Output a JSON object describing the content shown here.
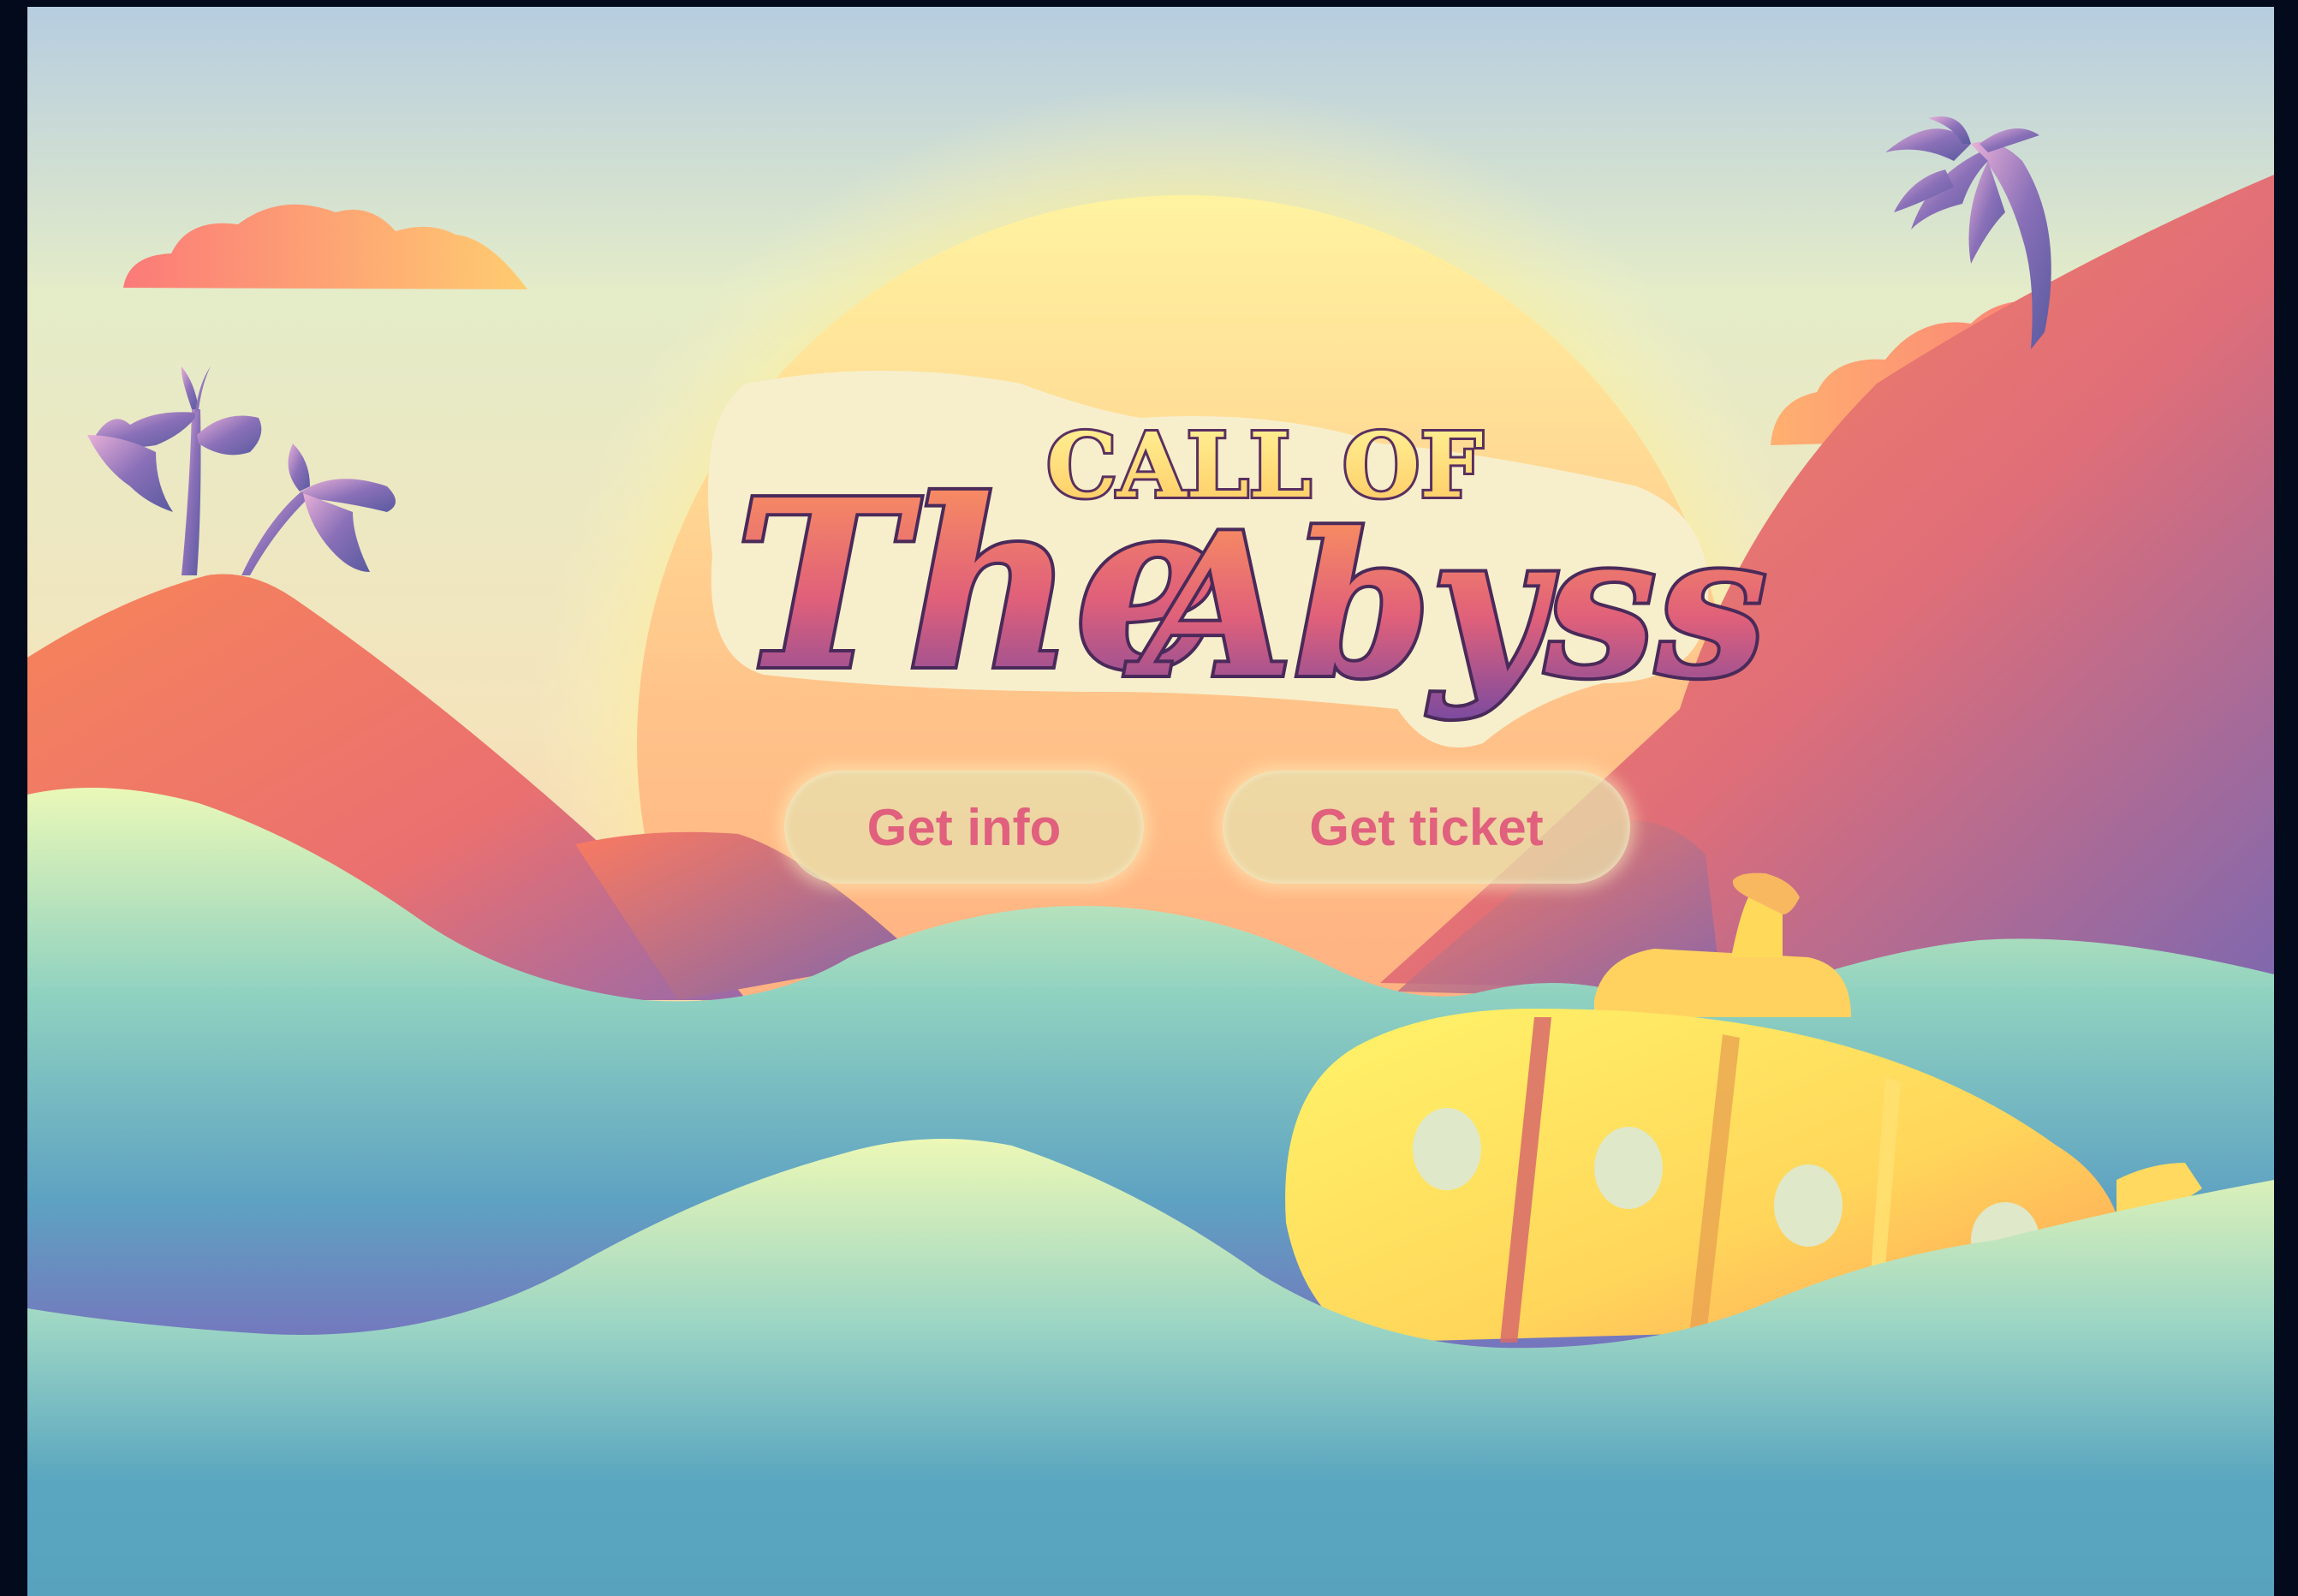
{
  "title": {
    "top_line": "CALL OF",
    "word_left": "The",
    "word_right": "Abyss"
  },
  "buttons": {
    "info_label": "Get info",
    "ticket_label": "Get ticket"
  },
  "colors": {
    "frame": "#030a1c",
    "sky_top": "#b9cfe0",
    "sky_mid": "#f2e8c0",
    "sun": "#fff3a0",
    "hill_orange": "#f4865a",
    "hill_purple": "#8a6aae",
    "wave_light": "#e6f5b4",
    "wave_teal": "#5aa6c0",
    "submarine": "#ffd65a",
    "button_text": "#e0607e",
    "button_bg": "#e8deaa"
  },
  "icons": {
    "left_palms": "palm-trees-icon",
    "right_palm": "palm-tree-icon",
    "submarine": "submarine-icon"
  }
}
